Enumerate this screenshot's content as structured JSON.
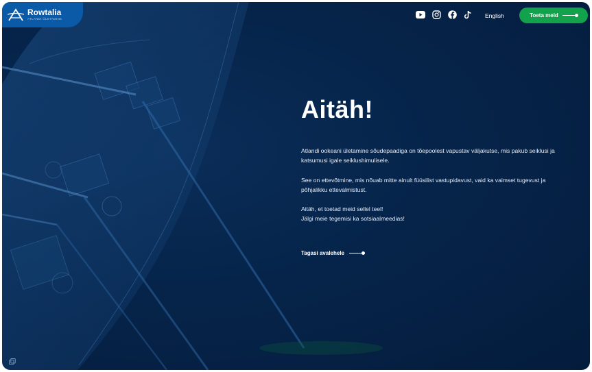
{
  "brand": {
    "name": "Rowtalia",
    "tagline": "ATLANDI ÜLETAMINE",
    "accent": "#0b5aa8"
  },
  "header": {
    "social_icons": [
      "youtube-icon",
      "instagram-icon",
      "facebook-icon",
      "tiktok-icon"
    ],
    "language_label": "English",
    "support_button_label": "Toeta meid",
    "support_button_color": "#12a24b"
  },
  "main": {
    "heading": "Aitäh!",
    "paragraph_1": "Atlandi ookeani ületamine sõudepaadiga on tõepoolest vapustav väljakutse, mis pakub seiklusi ja katsumusi igale seiklushimulisele.",
    "paragraph_2": "See on ettevõtmine, mis nõuab mitte ainult füüsilist vastupidavust, vaid ka vaimset tugevust ja põhjalikku ettevalmistust.",
    "paragraph_3_line_1": "Aitäh, et toetad meid sellel teel!",
    "paragraph_3_line_2": "Jälgi meie tegemisi ka sotsiaalmeedias!",
    "back_link_label": "Tagasi avalehele"
  },
  "colors": {
    "background": "#06244a",
    "text": "#ffffff"
  }
}
